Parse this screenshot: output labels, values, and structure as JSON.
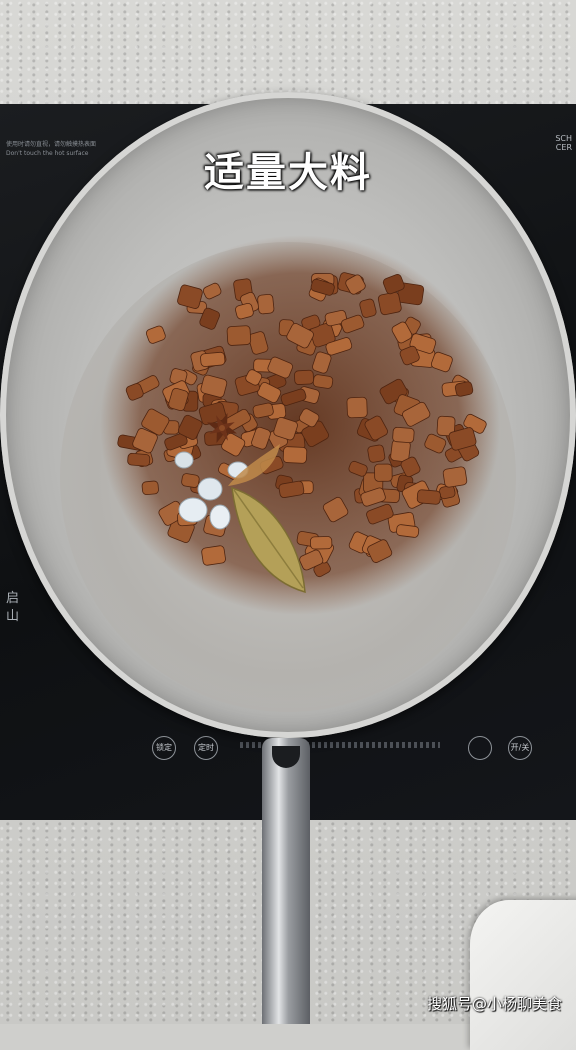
{
  "caption": "适量大料",
  "watermark": "搜狐号@小杨聊美食",
  "cooktop": {
    "warning_text": "使用时请勿直视，请勿触摸热表面\nDon't touch the hot surface",
    "brand_text": "SCH\nCER",
    "side_text": "启\n山",
    "controls": [
      {
        "label": "锁定"
      },
      {
        "label": "定时"
      },
      {
        "label": ""
      },
      {
        "label": "开/关"
      }
    ]
  },
  "colors": {
    "meat": "#8a4a26",
    "meat_highlight": "#b26a3a",
    "sauce": "#6b3418",
    "bay_leaf": "#b8a25a",
    "star_anise": "#6a2f17",
    "sugar": "#e8eef3"
  }
}
